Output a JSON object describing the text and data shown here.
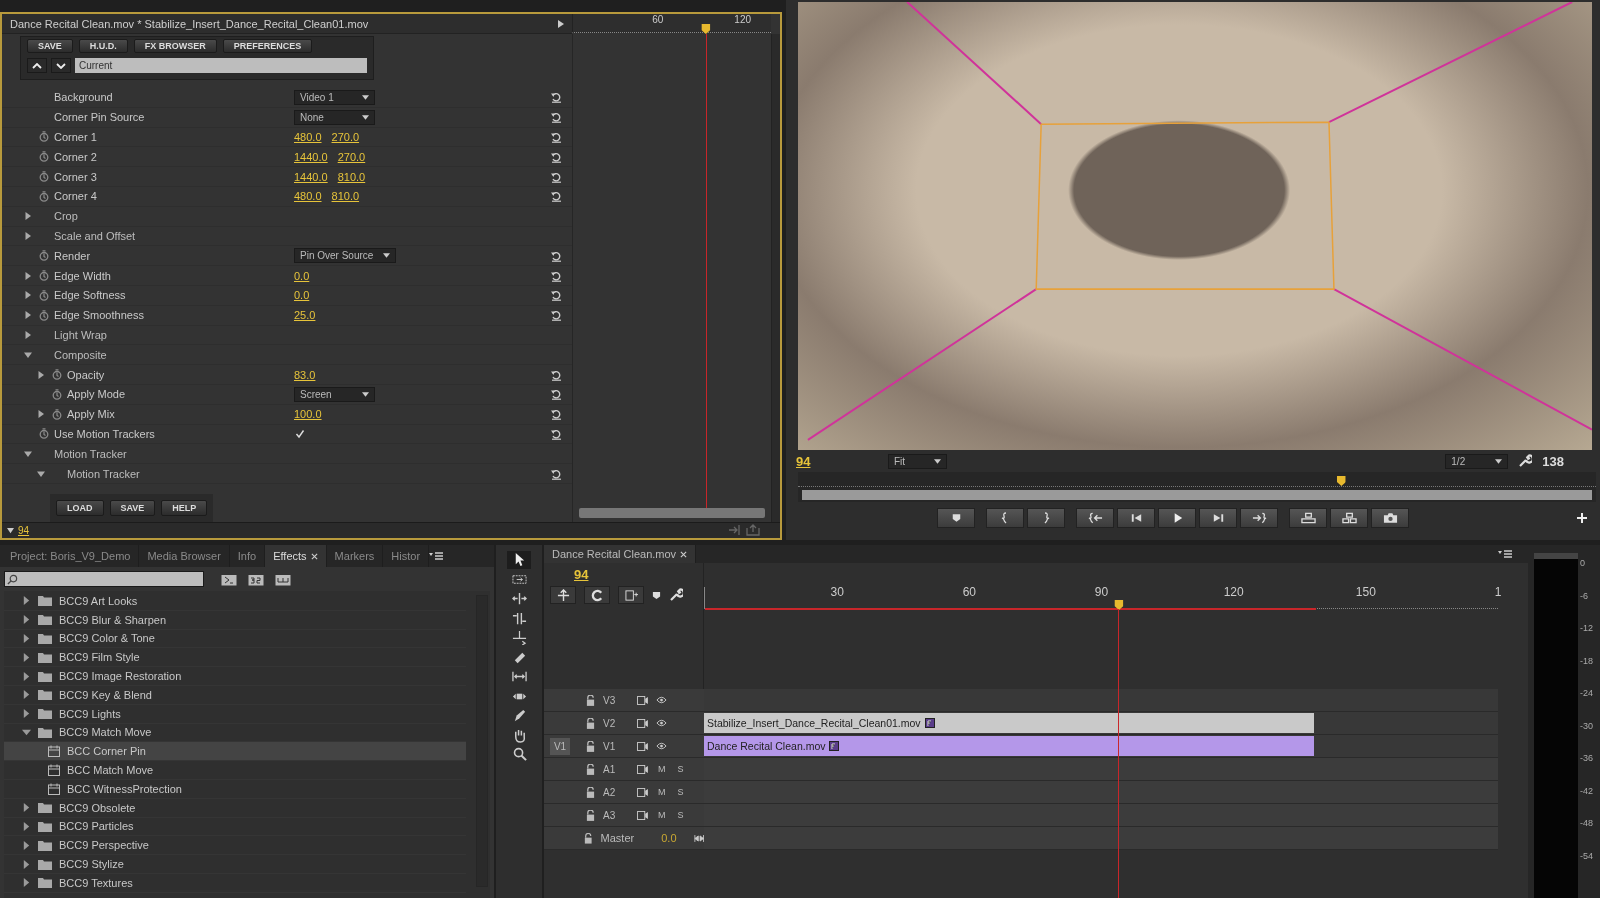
{
  "effect_controls": {
    "title": "Dance Recital Clean.mov * Stabilize_Insert_Dance_Recital_Clean01.mov",
    "ruler_ticks": [
      "60",
      "120"
    ],
    "playhead": {
      "level": 0.671
    },
    "toolbar": [
      "SAVE",
      "H.U.D.",
      "FX BROWSER",
      "PREFERENCES"
    ],
    "preset": "Current",
    "params": [
      {
        "kind": "dropdown",
        "label": "Background",
        "value": "Video 1",
        "keyframeable": false,
        "resettable": true
      },
      {
        "kind": "dropdown",
        "label": "Corner Pin Source",
        "value": "None",
        "keyframeable": false,
        "resettable": true
      },
      {
        "kind": "value",
        "label": "Corner 1",
        "values": [
          "480.0",
          "270.0"
        ],
        "keyframeable": true,
        "resettable": true
      },
      {
        "kind": "value",
        "label": "Corner 2",
        "values": [
          "1440.0",
          "270.0"
        ],
        "keyframeable": true,
        "resettable": true
      },
      {
        "kind": "value",
        "label": "Corner 3",
        "values": [
          "1440.0",
          "810.0"
        ],
        "keyframeable": true,
        "resettable": true
      },
      {
        "kind": "value",
        "label": "Corner 4",
        "values": [
          "480.0",
          "810.0"
        ],
        "keyframeable": true,
        "resettable": true
      },
      {
        "kind": "group",
        "label": "Crop",
        "expanded": false,
        "keyframeable": false,
        "resettable": false
      },
      {
        "kind": "group",
        "label": "Scale and Offset",
        "expanded": false,
        "keyframeable": false,
        "resettable": false
      },
      {
        "kind": "dropdown",
        "label": "Render",
        "value": "Pin Over Source",
        "keyframeable": true,
        "resettable": true
      },
      {
        "kind": "value",
        "label": "Edge Width",
        "values": [
          "0.0"
        ],
        "expanded": false,
        "keyframeable": true,
        "resettable": true
      },
      {
        "kind": "value",
        "label": "Edge Softness",
        "values": [
          "0.0"
        ],
        "expanded": false,
        "keyframeable": true,
        "resettable": true
      },
      {
        "kind": "value",
        "label": "Edge Smoothness",
        "values": [
          "25.0"
        ],
        "expanded": false,
        "keyframeable": true,
        "resettable": true
      },
      {
        "kind": "group",
        "label": "Light Wrap",
        "expanded": false,
        "keyframeable": false,
        "resettable": false
      },
      {
        "kind": "group",
        "label": "Composite",
        "expanded": true,
        "keyframeable": false,
        "resettable": false,
        "children": [
          {
            "kind": "value",
            "label": "Opacity",
            "values": [
              "83.0"
            ],
            "expanded": false,
            "keyframeable": true,
            "resettable": true
          },
          {
            "kind": "dropdown",
            "label": "Apply Mode",
            "value": "Screen",
            "keyframeable": true,
            "resettable": true
          },
          {
            "kind": "value",
            "label": "Apply Mix",
            "values": [
              "100.0"
            ],
            "expanded": false,
            "keyframeable": true,
            "resettable": true
          }
        ]
      },
      {
        "kind": "checkbox",
        "label": "Use Motion Trackers",
        "checked": true,
        "keyframeable": true,
        "resettable": true
      },
      {
        "kind": "group",
        "label": "Motion Tracker",
        "expanded": true,
        "keyframeable": false,
        "resettable": false,
        "children": [
          {
            "kind": "group",
            "label": "Motion Tracker",
            "expanded": true,
            "keyframeable": false,
            "resettable": true
          }
        ]
      }
    ],
    "footer_buttons": [
      "LOAD",
      "SAVE",
      "HELP"
    ],
    "timecode": "94"
  },
  "viewer": {
    "timecode": "94",
    "zoom": "Fit",
    "resolution": "1/2",
    "duration": "138",
    "scrubber": {
      "level": 0.681
    }
  },
  "effects_panel": {
    "tabs": [
      {
        "label": "Project: Boris_V9_Demo",
        "selected": false
      },
      {
        "label": "Media Browser",
        "selected": false
      },
      {
        "label": "Info",
        "selected": false
      },
      {
        "label": "Effects",
        "selected": true
      },
      {
        "label": "Markers",
        "selected": false
      },
      {
        "label": "Histor",
        "selected": false
      }
    ],
    "tree": [
      {
        "kind": "folder",
        "label": "BCC9 Art Looks",
        "expanded": false,
        "selected": false
      },
      {
        "kind": "folder",
        "label": "BCC9 Blur & Sharpen",
        "expanded": false,
        "selected": false
      },
      {
        "kind": "folder",
        "label": "BCC9 Color & Tone",
        "expanded": false,
        "selected": false
      },
      {
        "kind": "folder",
        "label": "BCC9 Film Style",
        "expanded": false,
        "selected": false
      },
      {
        "kind": "folder",
        "label": "BCC9 Image Restoration",
        "expanded": false,
        "selected": false
      },
      {
        "kind": "folder",
        "label": "BCC9 Key & Blend",
        "expanded": false,
        "selected": false
      },
      {
        "kind": "folder",
        "label": "BCC9 Lights",
        "expanded": false,
        "selected": false
      },
      {
        "kind": "folder",
        "label": "BCC9 Match Move",
        "expanded": true,
        "selected": false,
        "children": [
          {
            "kind": "effect",
            "label": "BCC Corner Pin",
            "selected": true
          },
          {
            "kind": "effect",
            "label": "BCC Match Move",
            "selected": false
          },
          {
            "kind": "effect",
            "label": "BCC WitnessProtection",
            "selected": false
          }
        ]
      },
      {
        "kind": "folder",
        "label": "BCC9 Obsolete",
        "expanded": false,
        "selected": false
      },
      {
        "kind": "folder",
        "label": "BCC9 Particles",
        "expanded": false,
        "selected": false
      },
      {
        "kind": "folder",
        "label": "BCC9 Perspective",
        "expanded": false,
        "selected": false
      },
      {
        "kind": "folder",
        "label": "BCC9 Stylize",
        "expanded": false,
        "selected": false
      },
      {
        "kind": "folder",
        "label": "BCC9 Textures",
        "expanded": false,
        "selected": false
      }
    ]
  },
  "timeline": {
    "tab": "Dance Recital Clean.mov",
    "timecode": "94",
    "ruler_ticks": [
      "30",
      "60",
      "90",
      "120",
      "150",
      "1"
    ],
    "playhead": {
      "level": 0.522
    },
    "video_tracks": [
      {
        "label": "V3"
      },
      {
        "label": "V2",
        "clip": {
          "name": "Stabilize_Insert_Dance_Recital_Clean01.mov",
          "color": "#c9c9c9"
        }
      },
      {
        "label": "V1",
        "source": "V1",
        "clip": {
          "name": "Dance Recital Clean.mov",
          "color": "#b497e9"
        }
      }
    ],
    "audio_tracks": [
      {
        "label": "A1",
        "mute": "M",
        "solo": "S"
      },
      {
        "label": "A2",
        "mute": "M",
        "solo": "S"
      },
      {
        "label": "A3",
        "mute": "M",
        "solo": "S"
      }
    ],
    "master": {
      "label": "Master",
      "value": "0.0"
    }
  },
  "audio_meter": {
    "ticks": [
      "0",
      "-6",
      "-12",
      "-18",
      "-24",
      "-30",
      "-36",
      "-42",
      "-48",
      "-54"
    ]
  }
}
